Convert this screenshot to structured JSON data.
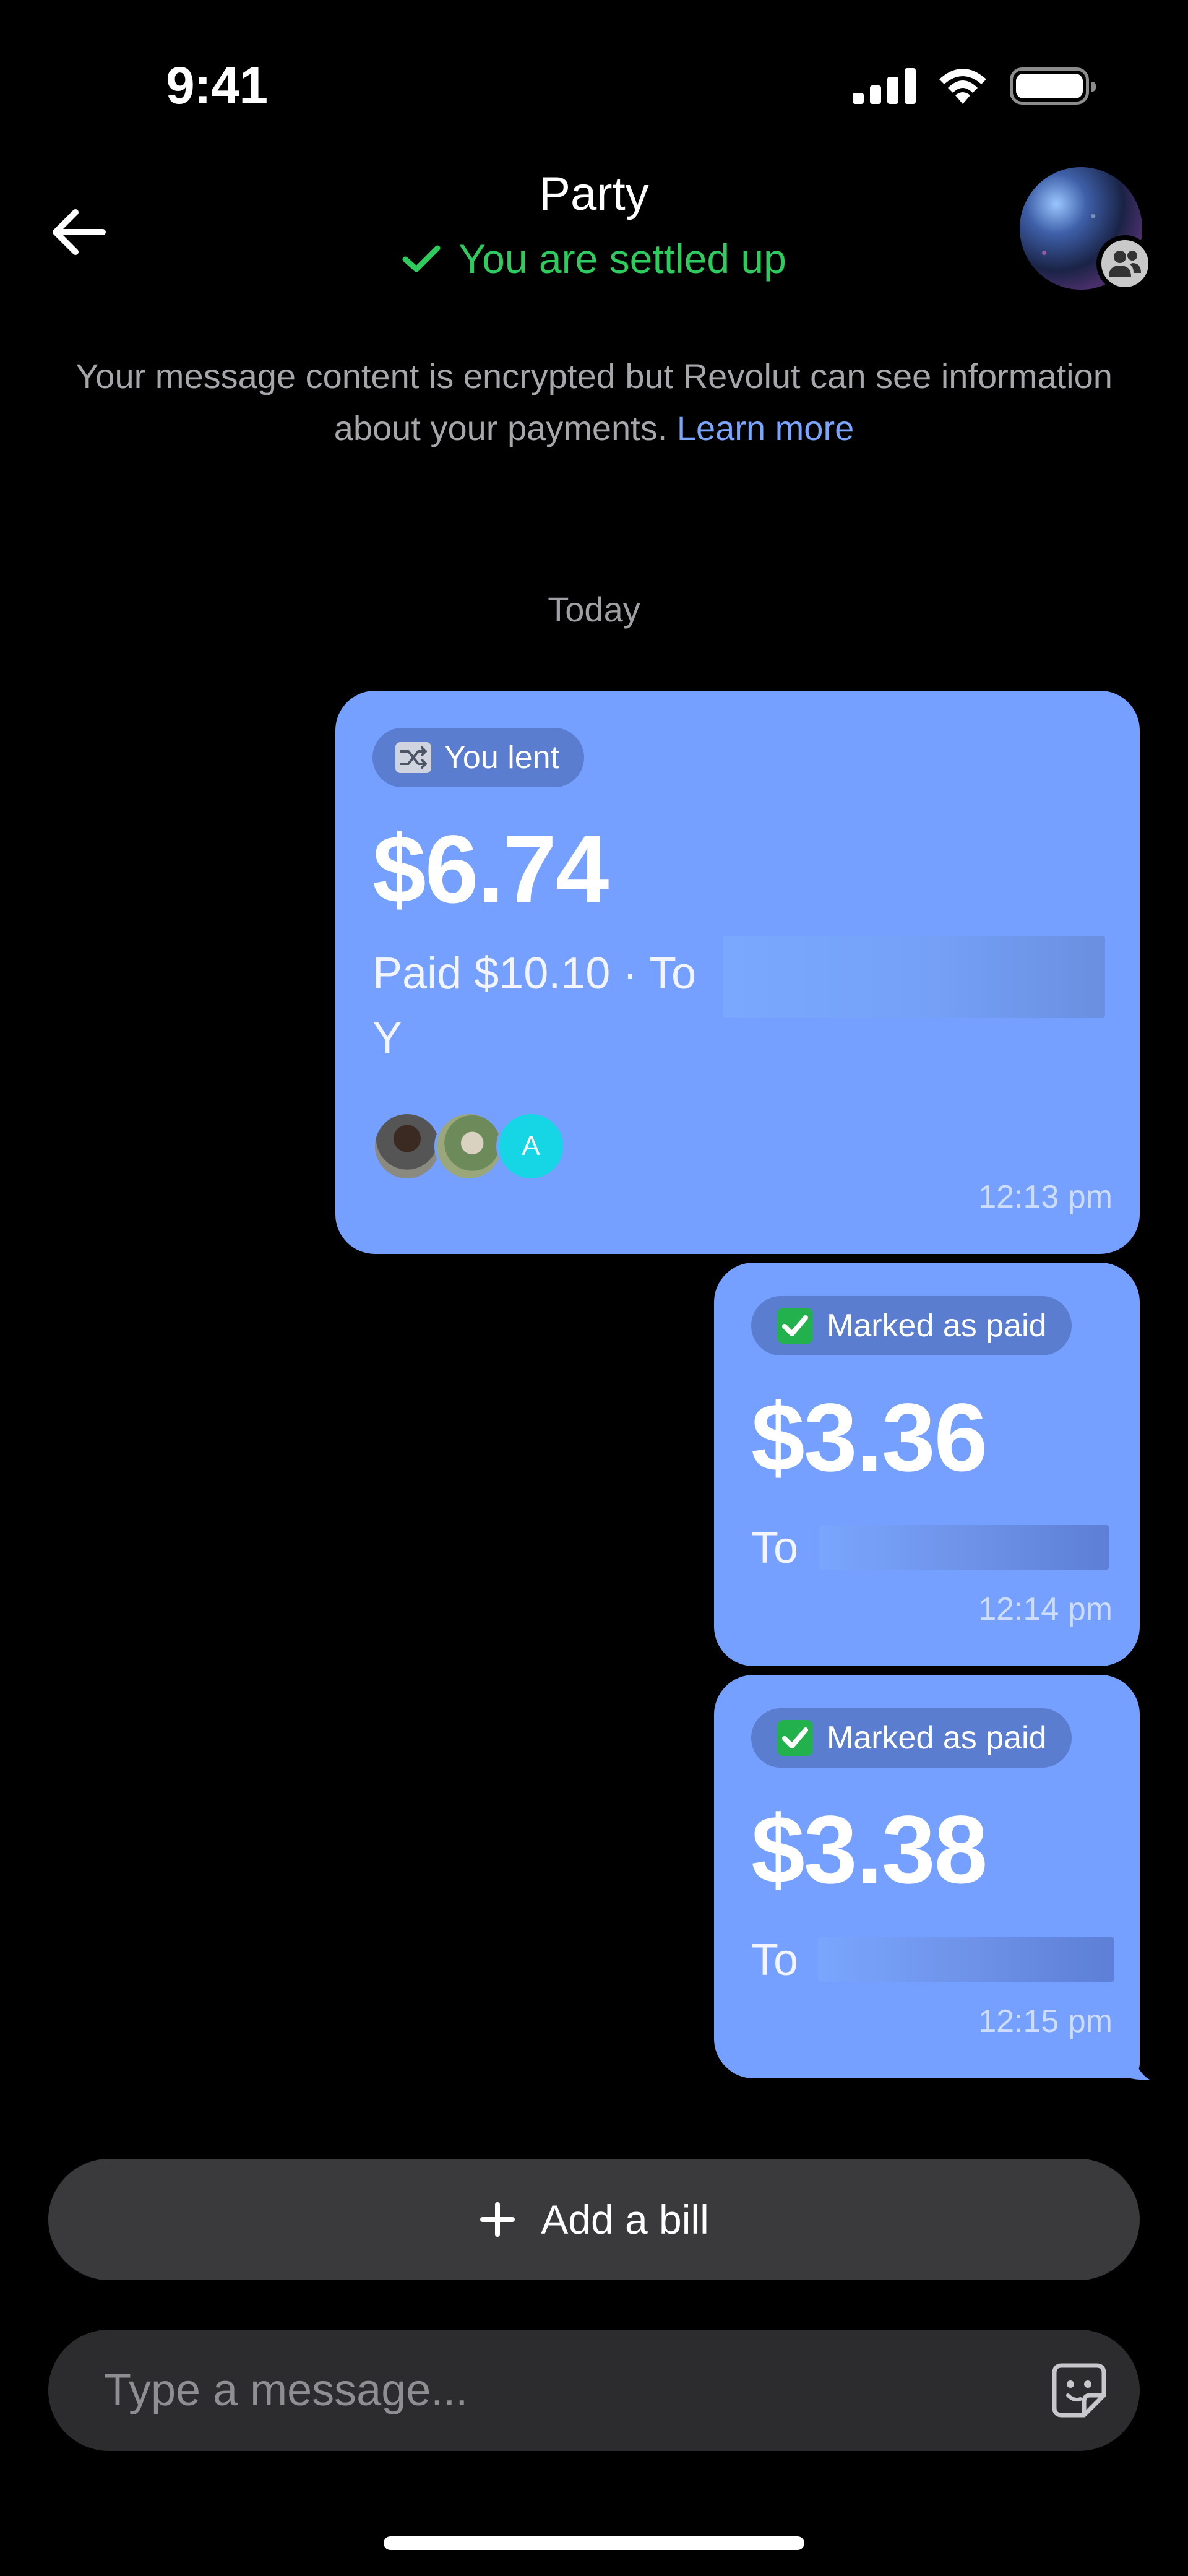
{
  "status_bar": {
    "time": "9:41"
  },
  "header": {
    "title": "Party",
    "settled_status": "You are settled up"
  },
  "notice": {
    "text": "Your message content is encrypted but Revolut can see information about your payments.",
    "link": "Learn more"
  },
  "date_separator": "Today",
  "messages": [
    {
      "chip": "You lent",
      "amount": "$6.74",
      "detail": "Paid $10.10 · To",
      "detail_second_line": "Y",
      "participant_initial": "A",
      "time": "12:13 pm"
    },
    {
      "chip": "Marked as paid",
      "amount": "$3.36",
      "to_label": "To",
      "time": "12:14 pm"
    },
    {
      "chip": "Marked as paid",
      "amount": "$3.38",
      "to_label": "To",
      "time": "12:15 pm"
    }
  ],
  "actions": {
    "add_bill": "Add a bill"
  },
  "composer": {
    "placeholder": "Type a message..."
  },
  "colors": {
    "bubble": "#76a0ff",
    "settled_green": "#2ecc5e",
    "link_blue": "#7aa6ff",
    "background": "#000000"
  },
  "icons": [
    "back-arrow-icon",
    "check-icon",
    "group-icon",
    "shuffle-icon",
    "checkbox-icon",
    "plus-icon",
    "sticker-icon",
    "signal-icon",
    "wifi-icon",
    "battery-icon"
  ]
}
